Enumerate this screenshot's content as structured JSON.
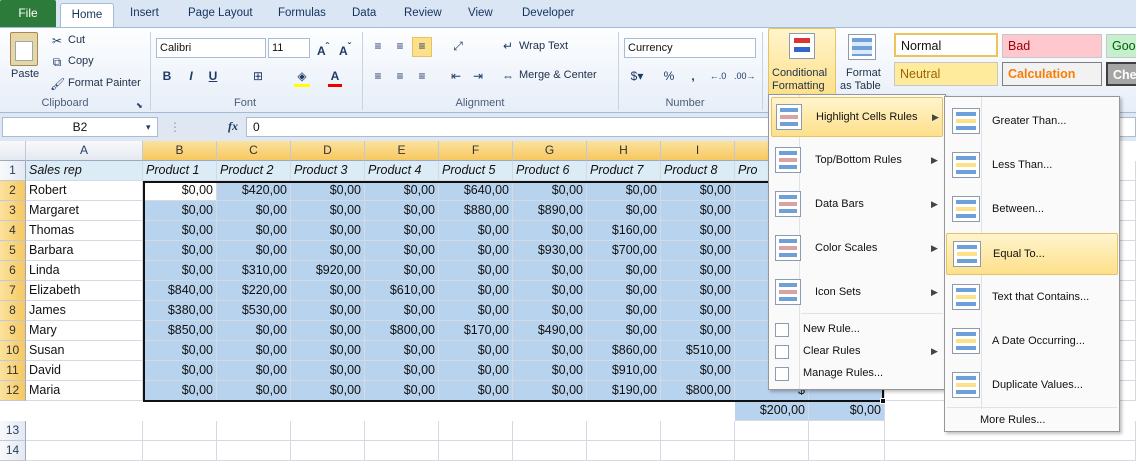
{
  "tabs": [
    "File",
    "Home",
    "Insert",
    "Page Layout",
    "Formulas",
    "Data",
    "Review",
    "View",
    "Developer"
  ],
  "clipboard": {
    "paste": "Paste",
    "cut": "Cut",
    "copy": "Copy",
    "format_painter": "Format Painter",
    "label": "Clipboard"
  },
  "font": {
    "name": "Calibri",
    "size": "11",
    "label": "Font",
    "bold": "B",
    "italic": "I",
    "underline": "U"
  },
  "alignment": {
    "wrap": "Wrap Text",
    "merge": "Merge & Center",
    "label": "Alignment"
  },
  "number": {
    "format": "Currency",
    "percent": "%",
    "comma": ",",
    "label": "Number"
  },
  "styles": {
    "cond_fmt": "Conditional",
    "cond_fmt2": "Formatting",
    "format_table": "Format",
    "format_table2": "as Table",
    "normal": "Normal",
    "bad": "Bad",
    "good": "Goo",
    "neutral": "Neutral",
    "calculation": "Calculation",
    "check": "Che"
  },
  "formula_bar": {
    "name_box": "B2",
    "fx": "fx",
    "value": "0"
  },
  "columns": [
    "A",
    "B",
    "C",
    "D",
    "E",
    "F",
    "G",
    "H",
    "I"
  ],
  "header_row": [
    "Sales rep",
    "Product 1",
    "Product 2",
    "Product 3",
    "Product 4",
    "Product 5",
    "Product 6",
    "Product 7",
    "Product 8",
    "Pro"
  ],
  "rows": [
    {
      "n": "2",
      "name": "Robert",
      "vals": [
        "$0,00",
        "$420,00",
        "$0,00",
        "$0,00",
        "$640,00",
        "$0,00",
        "$0,00",
        "$0,00"
      ]
    },
    {
      "n": "3",
      "name": "Margaret",
      "vals": [
        "$0,00",
        "$0,00",
        "$0,00",
        "$0,00",
        "$880,00",
        "$890,00",
        "$0,00",
        "$0,00"
      ]
    },
    {
      "n": "4",
      "name": "Thomas",
      "vals": [
        "$0,00",
        "$0,00",
        "$0,00",
        "$0,00",
        "$0,00",
        "$0,00",
        "$160,00",
        "$0,00"
      ]
    },
    {
      "n": "5",
      "name": "Barbara",
      "vals": [
        "$0,00",
        "$0,00",
        "$0,00",
        "$0,00",
        "$0,00",
        "$930,00",
        "$700,00",
        "$0,00"
      ]
    },
    {
      "n": "6",
      "name": "Linda",
      "vals": [
        "$0,00",
        "$310,00",
        "$920,00",
        "$0,00",
        "$0,00",
        "$0,00",
        "$0,00",
        "$0,00"
      ]
    },
    {
      "n": "7",
      "name": "Elizabeth",
      "vals": [
        "$840,00",
        "$220,00",
        "$0,00",
        "$610,00",
        "$0,00",
        "$0,00",
        "$0,00",
        "$0,00"
      ]
    },
    {
      "n": "8",
      "name": "James",
      "vals": [
        "$380,00",
        "$530,00",
        "$0,00",
        "$0,00",
        "$0,00",
        "$0,00",
        "$0,00",
        "$0,00"
      ]
    },
    {
      "n": "9",
      "name": "Mary",
      "vals": [
        "$850,00",
        "$0,00",
        "$0,00",
        "$800,00",
        "$170,00",
        "$490,00",
        "$0,00",
        "$0,00"
      ]
    },
    {
      "n": "10",
      "name": "Susan",
      "vals": [
        "$0,00",
        "$0,00",
        "$0,00",
        "$0,00",
        "$0,00",
        "$0,00",
        "$860,00",
        "$510,00"
      ]
    },
    {
      "n": "11",
      "name": "David",
      "vals": [
        "$0,00",
        "$0,00",
        "$0,00",
        "$0,00",
        "$0,00",
        "$0,00",
        "$910,00",
        "$0,00"
      ]
    },
    {
      "n": "12",
      "name": "Maria",
      "vals": [
        "$0,00",
        "$0,00",
        "$0,00",
        "$0,00",
        "$0,00",
        "$0,00",
        "$190,00",
        "$800,00"
      ]
    }
  ],
  "extra_rows": [
    "13",
    "14"
  ],
  "partial": {
    "r10": "$",
    "r11": "$",
    "r12a": "$200,00",
    "r12b": "$0,00"
  },
  "cf_menu": [
    {
      "label": "Highlight Cells Rules",
      "icon": "highlight-cells-icon"
    },
    {
      "label": "Top/Bottom Rules",
      "icon": "top-bottom-icon"
    },
    {
      "label": "Data Bars",
      "icon": "data-bars-icon"
    },
    {
      "label": "Color Scales",
      "icon": "color-scales-icon"
    },
    {
      "label": "Icon Sets",
      "icon": "icon-sets-icon"
    },
    {
      "label": "New Rule...",
      "icon": "new-rule-icon"
    },
    {
      "label": "Clear Rules",
      "icon": "clear-rules-icon"
    },
    {
      "label": "Manage Rules...",
      "icon": "manage-rules-icon"
    }
  ],
  "hc_menu": [
    {
      "label": "Greater Than..."
    },
    {
      "label": "Less Than..."
    },
    {
      "label": "Between..."
    },
    {
      "label": "Equal To..."
    },
    {
      "label": "Text that Contains..."
    },
    {
      "label": "A Date Occurring..."
    },
    {
      "label": "Duplicate Values..."
    },
    {
      "label": "More Rules..."
    }
  ],
  "colors": {
    "accent": "#b8d3ee",
    "file_tab": "#2c7b3a",
    "hover": "#fde08a"
  }
}
